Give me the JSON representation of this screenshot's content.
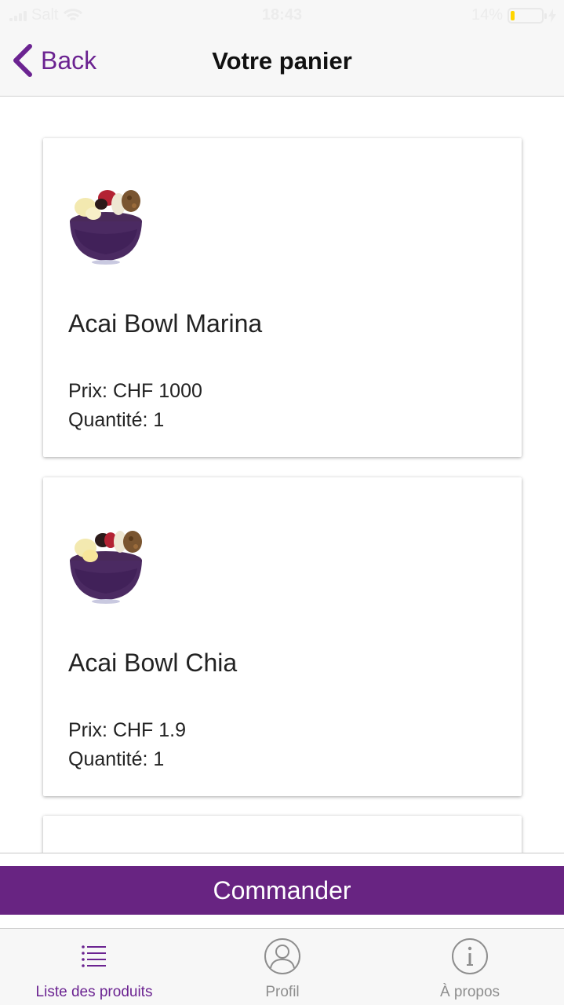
{
  "status_bar": {
    "carrier": "Salt",
    "time": "18:43",
    "battery": "14%",
    "battery_level": 0.14
  },
  "nav": {
    "back_label": "Back",
    "title": "Votre panier"
  },
  "cart": {
    "items": [
      {
        "name": "Acai Bowl Marina",
        "price_label": "Prix: CHF 1000",
        "quantity_label": "Quantité: 1",
        "image_icon": "acai-bowl-image"
      },
      {
        "name": "Acai Bowl Chia",
        "price_label": "Prix: CHF 1.9",
        "quantity_label": "Quantité: 1",
        "image_icon": "acai-bowl-image"
      }
    ]
  },
  "order_button": {
    "label": "Commander"
  },
  "tabs": [
    {
      "label": "Liste des produits",
      "icon": "list-icon",
      "active": true
    },
    {
      "label": "Profil",
      "icon": "profile-icon",
      "active": false
    },
    {
      "label": "À propos",
      "icon": "info-icon",
      "active": false
    }
  ],
  "colors": {
    "accent": "#6b2391",
    "order_button": "#682482",
    "battery_fill": "#ffd500",
    "inactive_tab": "#8e8e8e"
  }
}
